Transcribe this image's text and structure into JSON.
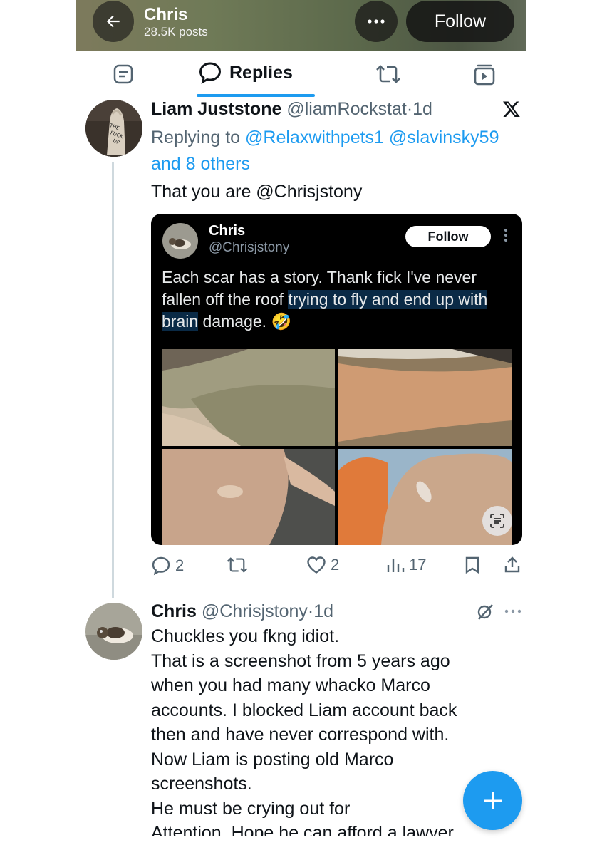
{
  "header": {
    "name": "Chris",
    "posts": "28.5K posts",
    "follow_label": "Follow"
  },
  "tabs": {
    "replies_label": "Replies"
  },
  "tweet1": {
    "author_name": "Liam Juststone",
    "author_handle": "@liamRockstat",
    "time": "·1d",
    "replying_prefix": "Replying to",
    "replying_handles": "@Relaxwithpets1 @slavinsky59",
    "replying_others": "and 8 others",
    "text": "That you are @Chrisjstony",
    "embed": {
      "name": "Chris",
      "handle": "@Chrisjstony",
      "follow_label": "Follow",
      "text_plain_1": "Each scar has a story. Thank fick I've never fallen off the roof ",
      "text_highlight": "trying to fly and end up with brain",
      "text_plain_2": " damage. 🤣"
    },
    "stats": {
      "replies": "2",
      "likes": "2",
      "views": "17"
    }
  },
  "tweet2": {
    "author_name": "Chris",
    "author_handle": "@Chrisjstony",
    "time": "·1d",
    "lines": [
      "Chuckles you fkng idiot.",
      "That is a screenshot from 5 years ago",
      "when you had many whacko Marco",
      "accounts. I blocked Liam account back",
      "then and have never correspond with.",
      "Now Liam is posting old Marco",
      "screenshots.",
      "He must be crying out for",
      "Attention. Hope he can afford a lawyer"
    ]
  },
  "colors": {
    "accent": "#1d9bf0",
    "secondary_text": "#536471",
    "primary_text": "#0f1419"
  },
  "icons": {
    "back": "arrow-left-icon",
    "more": "more-horizontal-icon",
    "posts_tab": "posts-icon",
    "replies_tab": "speech-bubble-icon",
    "reposts_tab": "repost-icon",
    "media_tab": "media-icon",
    "x_logo": "x-logo-icon",
    "compose": "plus-icon"
  }
}
